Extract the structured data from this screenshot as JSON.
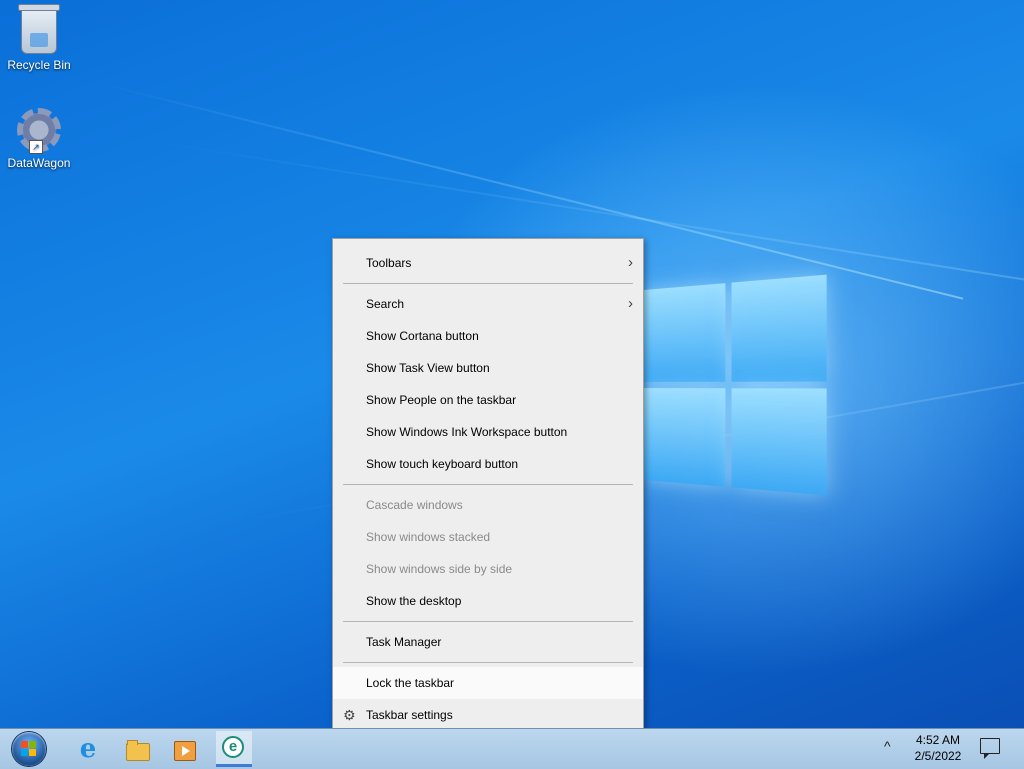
{
  "desktop": {
    "icons": [
      {
        "label": "Recycle Bin",
        "icon": "recycle-bin-icon"
      },
      {
        "label": "DataWagon",
        "icon": "datawagon-gear-icon"
      }
    ]
  },
  "context_menu": {
    "items": {
      "toolbars": "Toolbars",
      "search": "Search",
      "show_cortana": "Show Cortana button",
      "show_task_view": "Show Task View button",
      "show_people": "Show People on the taskbar",
      "show_ink": "Show Windows Ink Workspace button",
      "show_touch_keyboard": "Show touch keyboard button",
      "cascade": "Cascade windows",
      "stacked": "Show windows stacked",
      "side_by_side": "Show windows side by side",
      "show_desktop": "Show the desktop",
      "task_manager": "Task Manager",
      "lock_taskbar": "Lock the taskbar",
      "taskbar_settings": "Taskbar settings"
    },
    "submenu_arrow": "›",
    "settings_glyph": "⚙"
  },
  "taskbar": {
    "apps": [
      {
        "name": "internet-explorer",
        "glyph": "e"
      },
      {
        "name": "file-explorer"
      },
      {
        "name": "media-player"
      },
      {
        "name": "eset",
        "glyph": "e"
      }
    ],
    "tray_arrow": "^",
    "clock": {
      "time": "4:52 AM",
      "date": "2/5/2022"
    }
  },
  "colors": {
    "desktop_blue": "#0a6fd8",
    "menu_bg": "#eeeeee",
    "taskbar_bg": "#bcd7ee",
    "eset_teal": "#1a8d7a"
  }
}
